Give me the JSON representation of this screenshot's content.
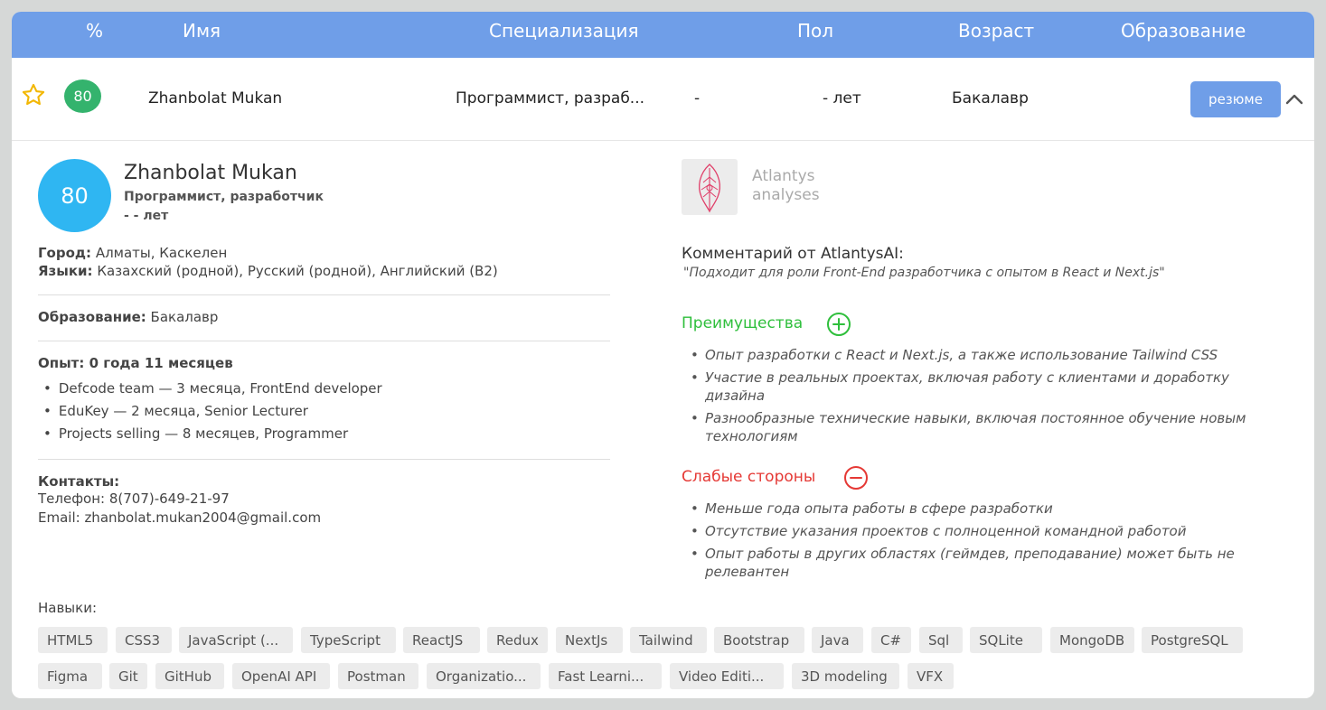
{
  "header": {
    "percent": "%",
    "name": "Имя",
    "specialization": "Специализация",
    "gender": "Пол",
    "age": "Возраст",
    "education": "Образование"
  },
  "row": {
    "score": "80",
    "name": "Zhanbolat Mukan",
    "specialization": "Программист, разраб...",
    "gender": "-",
    "age": "- лет",
    "education": "Бакалавр",
    "resume_label": "резюме"
  },
  "profile": {
    "score": "80",
    "name": "Zhanbolat Mukan",
    "specialization": "Программист, разработчик",
    "age": "- - лет",
    "city_label": "Город:",
    "city_value": "Алматы, Каскелен",
    "languages_label": "Языки:",
    "languages_value": "Казахский (родной), Русский (родной), Английский (B2)",
    "education_label": "Образование:",
    "education_value": "Бакалавр",
    "experience_title": "Опыт: 0 года 11 месяцев",
    "experience": [
      "Defcode team — 3 месяца, FrontEnd developer",
      "EduKey — 2 месяца, Senior Lecturer",
      "Projects selling — 8 месяцев, Programmer"
    ],
    "contacts_label": "Контакты:",
    "phone": "Телефон: 8(707)-649-21-97",
    "email": "Email: zhanbolat.mukan2004@gmail.com",
    "skills_label": "Навыки:"
  },
  "analysis": {
    "logo_line1": "Atlantys",
    "logo_line2": "analyses",
    "comment_title": "Комментарий от AtlantysAI:",
    "comment_text": "\"Подходит для роли Front-End разработчика с опытом в React и Next.js\"",
    "pros_title": "Преимущества",
    "pros": [
      "Опыт разработки с React и Next.js, а также использование Tailwind CSS",
      "Участие в реальных проектах, включая работу с клиентами и доработку дизайна",
      "Разнообразные технические навыки, включая постоянное обучение новым технологиям"
    ],
    "cons_title": "Слабые стороны",
    "cons": [
      "Меньше года опыта работы в сфере разработки",
      "Отсутствие указания проектов с полноценной командной работой",
      "Опыт работы в других областях (геймдев, преподавание) может быть не релевантен"
    ]
  },
  "skills": [
    "HTML5",
    "CSS3",
    "JavaScript (...",
    "TypeScript",
    "ReactJS",
    "Redux",
    "NextJs",
    "Tailwind",
    "Bootstrap",
    "Java",
    "C#",
    "Sql",
    "SQLite",
    "MongoDB",
    "PostgreSQL",
    "Figma",
    "Git",
    "GitHub",
    "OpenAI API",
    "Postman",
    "Organizatio...",
    "Fast Learni...",
    "Video Editi...",
    "3D modeling",
    "VFX"
  ],
  "colors": {
    "header": "#6f9ee8",
    "score_badge": "#34b36d",
    "big_score": "#2fb6f2",
    "pros": "#2fbf3c",
    "cons": "#e53935",
    "star": "#f2b705"
  },
  "icons": {
    "favorite": "star-icon",
    "collapse": "chevron-up-icon",
    "pros": "plus-circle-icon",
    "cons": "minus-circle-icon",
    "logo": "atlantys-logo-icon"
  }
}
